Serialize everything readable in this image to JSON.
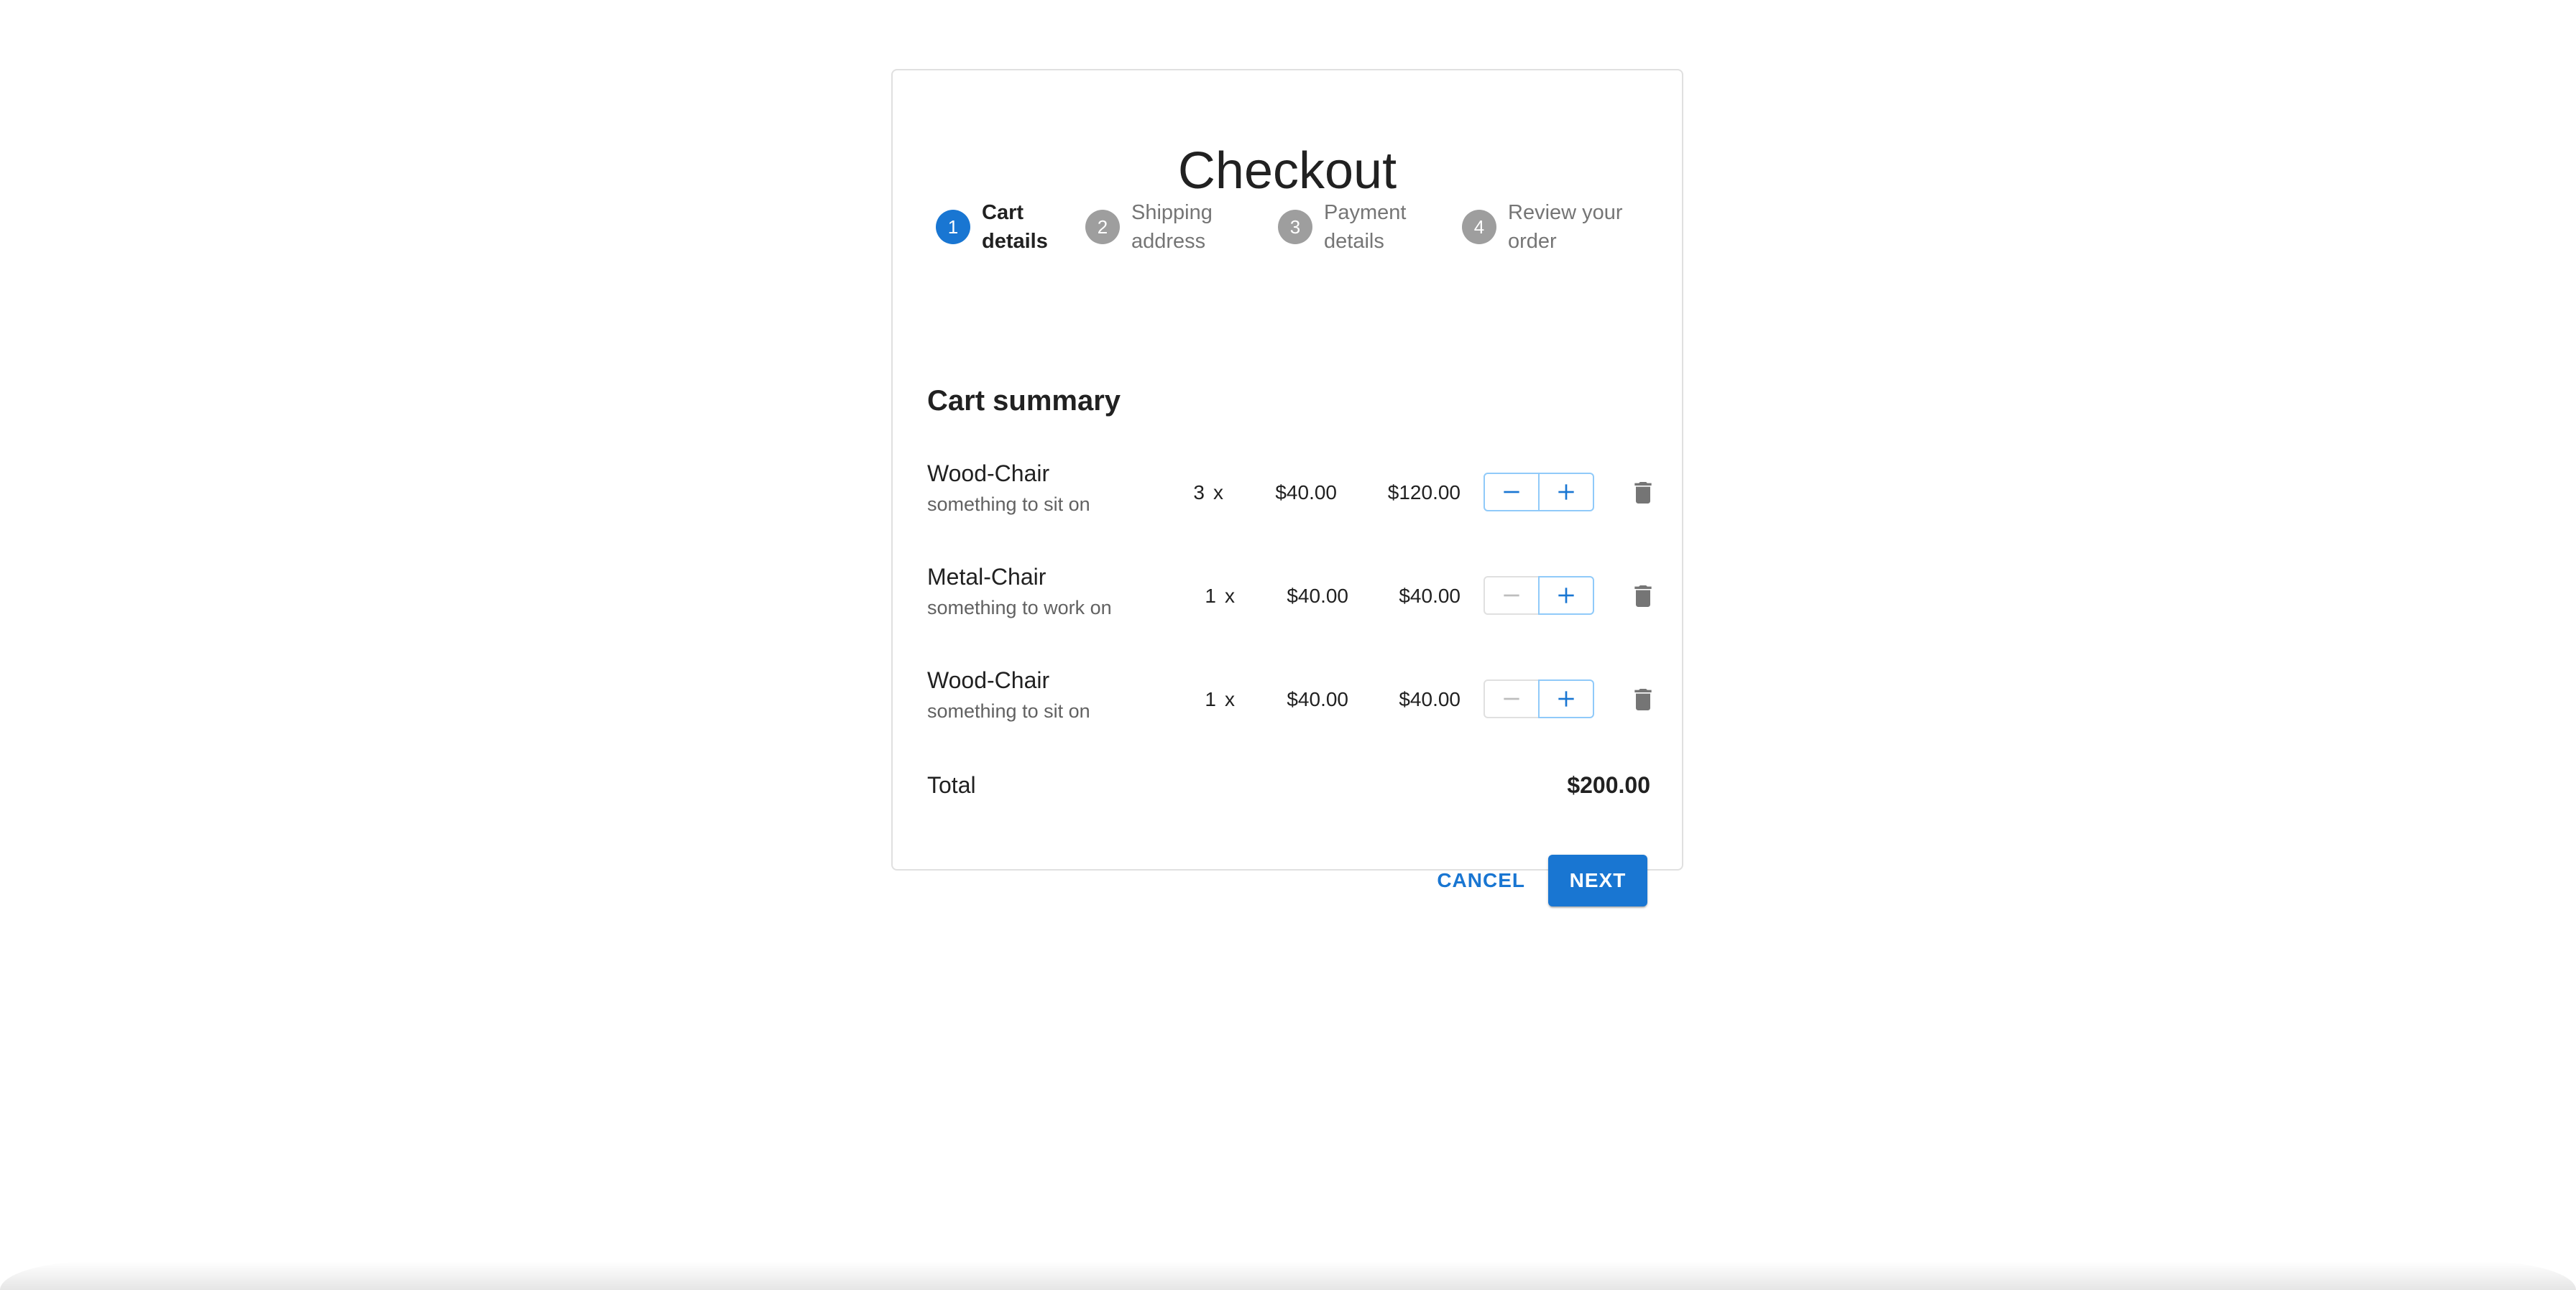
{
  "checkout": {
    "title": "Checkout",
    "steps": [
      {
        "number": "1",
        "line1": "Cart",
        "line2": "details",
        "active": true
      },
      {
        "number": "2",
        "line1": "Shipping",
        "line2": "address",
        "active": false
      },
      {
        "number": "3",
        "line1": "Payment",
        "line2": "details",
        "active": false
      },
      {
        "number": "4",
        "line1": "Review your",
        "line2": "order",
        "active": false
      }
    ],
    "cart": {
      "title": "Cart summary",
      "items": [
        {
          "name": "Wood-Chair",
          "description": "something to sit on",
          "quantity": "3",
          "times": "x",
          "unit_price": "$40.00",
          "line_total": "$120.00",
          "minus_enabled": true
        },
        {
          "name": "Metal-Chair",
          "description": "something to work on",
          "quantity": "1",
          "times": "x",
          "unit_price": "$40.00",
          "line_total": "$40.00",
          "minus_enabled": false
        },
        {
          "name": "Wood-Chair",
          "description": "something to sit on",
          "quantity": "1",
          "times": "x",
          "unit_price": "$40.00",
          "line_total": "$40.00",
          "minus_enabled": false
        }
      ],
      "total_label": "Total",
      "total_value": "$200.00"
    },
    "actions": {
      "cancel_label": "CANCEL",
      "next_label": "NEXT"
    }
  },
  "icons": {
    "decrement": "minus-icon",
    "increment": "plus-icon",
    "delete": "trash-icon"
  },
  "colors": {
    "primary": "#1976d2",
    "inactive_step": "#9e9e9e",
    "outline": "#90caf9",
    "disabled_outline": "#e0e0e0",
    "trash": "#757575"
  }
}
